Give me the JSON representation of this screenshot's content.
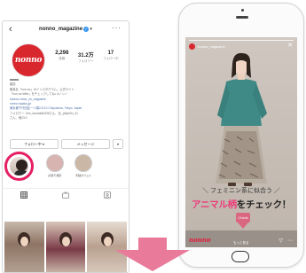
{
  "left_phone": {
    "header": {
      "back_icon": "chevron-left-icon",
      "username": "nonno_magazine",
      "more_icon": "more-dots-icon"
    },
    "avatar_logo": "nonno",
    "stats": [
      {
        "value": "2,298",
        "label": "投稿"
      },
      {
        "value": "31.2万",
        "label": "フォロワー"
      },
      {
        "value": "17",
        "label": "フォロー中"
      }
    ],
    "bio_lines": [
      "nonno",
      "雑誌",
      "集英社「non-no」のインスタグラム。公式サイト",
      "「non-no Web」をチェックしてね♪ #ノンノ",
      "#nonno #non_no_magazine",
      "nonno.hpplus.jp/",
      "東京都千代田区一ツ橋2-5-10 Chiyoda-ku, Tokyo, Japan",
      "フォロワー: riho_kumaba0336さん、社_prilpe0o_31",
      "さん、他23人"
    ],
    "buttons": {
      "follow": "フォロー中 ▾",
      "message": "メッセージ",
      "more": "▾"
    },
    "highlights": [
      "",
      "読者モ撮影",
      "手越のウェル"
    ],
    "tabs": [
      "grid-icon",
      "igtv-icon",
      "tagged-icon"
    ]
  },
  "right_phone": {
    "story_account": "nonno_magazine",
    "subtitle": "＼ フェミニン系に似合う ／",
    "title_accent": "アニマル柄",
    "title_rest": "をチェック！",
    "check_label": "Check",
    "logo": "nonno",
    "footer_text": "もっと見る",
    "footer_icons": [
      "send-icon",
      "more-dots-icon"
    ]
  },
  "colors": {
    "brand_red": "#d9272e",
    "story_ring": "#e61f63",
    "accent_pink": "#ec3b78",
    "arrow_pink": "#e97a9a"
  }
}
